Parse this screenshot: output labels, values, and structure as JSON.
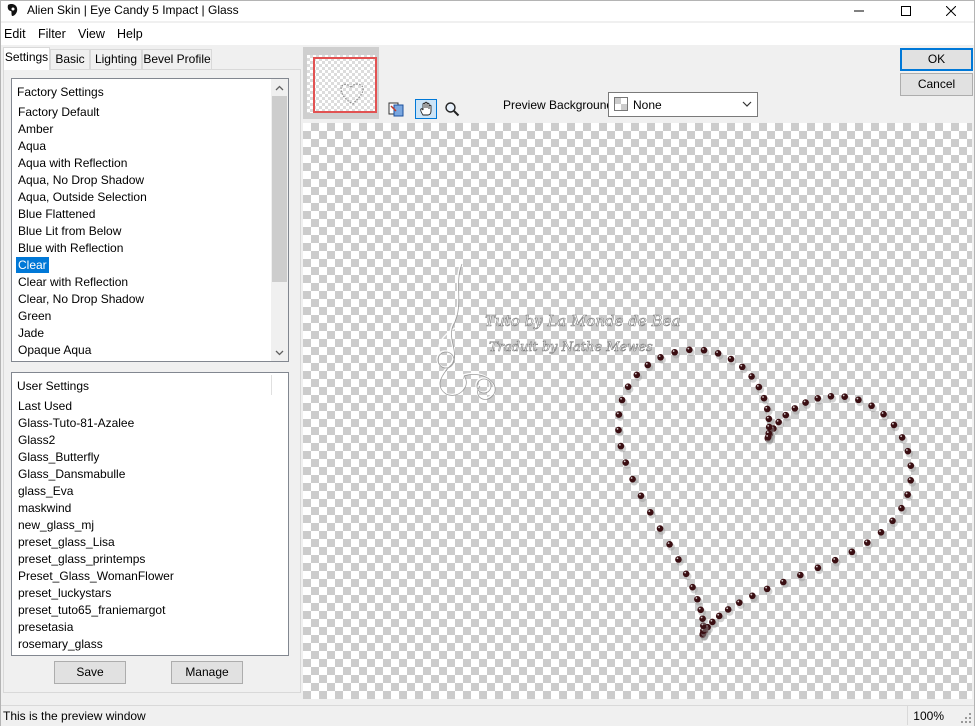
{
  "window": {
    "title": "Alien Skin | Eye Candy 5 Impact | Glass"
  },
  "menu": [
    "Edit",
    "Filter",
    "View",
    "Help"
  ],
  "tabs": [
    "Settings",
    "Basic",
    "Lighting",
    "Bevel Profile"
  ],
  "factory_settings": {
    "header": "Factory Settings",
    "items": [
      "Factory Default",
      "Amber",
      "Aqua",
      "Aqua with Reflection",
      "Aqua, No Drop Shadow",
      "Aqua, Outside Selection",
      "Blue Flattened",
      "Blue Lit from Below",
      "Blue with Reflection",
      "Clear",
      "Clear with Reflection",
      "Clear, No Drop Shadow",
      "Green",
      "Jade",
      "Opaque Aqua"
    ],
    "selected": "Clear"
  },
  "user_settings": {
    "header": "User Settings",
    "items": [
      "Last Used",
      "Glass-Tuto-81-Azalee",
      "Glass2",
      "Glass_Butterfly",
      "Glass_Dansmabulle",
      "glass_Eva",
      "maskwind",
      "new_glass_mj",
      "preset_glass_Lisa",
      "preset_glass_printemps",
      "Preset_Glass_WomanFlower",
      "preset_luckystars",
      "preset_tuto65_franiemargot",
      "presetasia",
      "rosemary_glass"
    ]
  },
  "buttons": {
    "save": "Save",
    "manage": "Manage",
    "ok": "OK",
    "cancel": "Cancel"
  },
  "preview": {
    "background_label": "Preview Background:",
    "background_value": "None",
    "watermark_line1": "Tuto by La Monde de Bea",
    "watermark_line2": "Traduit by Nathe Mewes"
  },
  "status": {
    "text": "This is the preview window",
    "zoom": "100%"
  },
  "colors": {
    "accent": "#0078d7",
    "bead": "#3a0e12",
    "nav_frame": "#e25252"
  }
}
